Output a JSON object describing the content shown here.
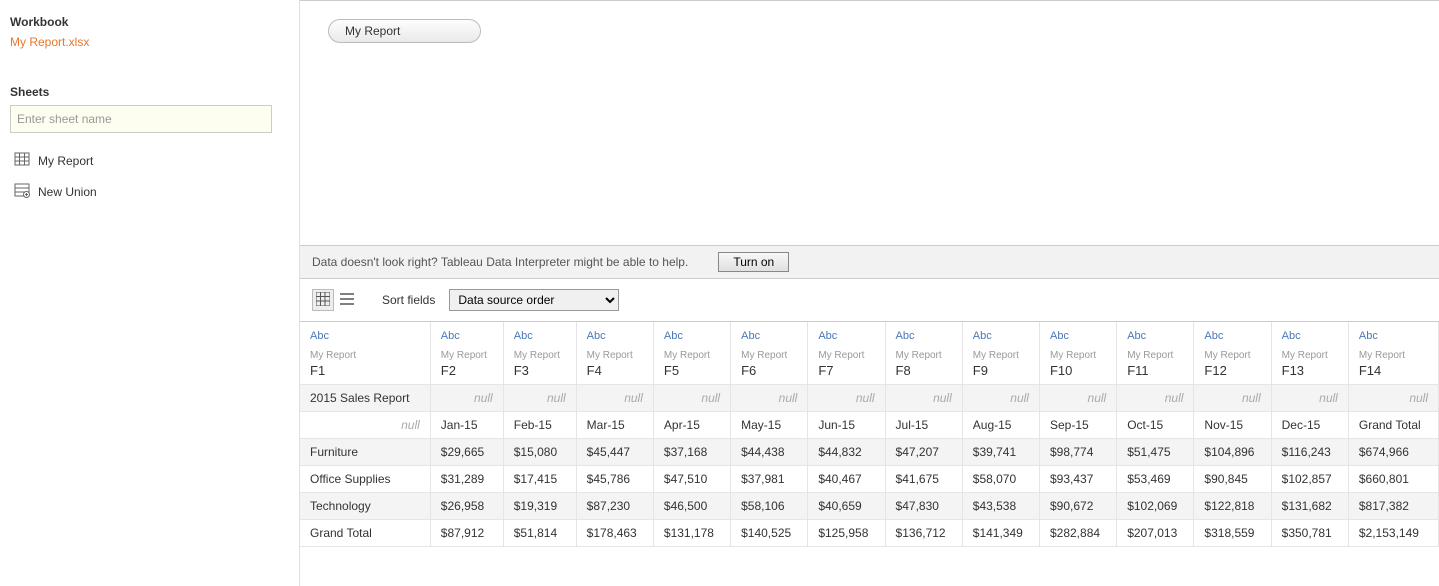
{
  "sidebar": {
    "workbook_label": "Workbook",
    "file_name": "My Report.xlsx",
    "sheets_label": "Sheets",
    "sheet_search_placeholder": "Enter sheet name",
    "sheet_item": "My Report",
    "new_union": "New Union"
  },
  "canvas": {
    "pill_label": "My Report"
  },
  "interpreter": {
    "message": "Data doesn't look right? Tableau Data Interpreter might be able to help.",
    "button": "Turn on"
  },
  "controls": {
    "sort_label": "Sort fields",
    "sort_value": "Data source order"
  },
  "grid": {
    "col_type": "Abc",
    "col_source": "My Report",
    "columns": [
      "F1",
      "F2",
      "F3",
      "F4",
      "F5",
      "F6",
      "F7",
      "F8",
      "F9",
      "F10",
      "F11",
      "F12",
      "F13",
      "F14"
    ],
    "null_text": "null",
    "rows": [
      [
        "2015 Sales Report",
        null,
        null,
        null,
        null,
        null,
        null,
        null,
        null,
        null,
        null,
        null,
        null,
        null
      ],
      [
        null,
        "Jan-15",
        "Feb-15",
        "Mar-15",
        "Apr-15",
        "May-15",
        "Jun-15",
        "Jul-15",
        "Aug-15",
        "Sep-15",
        "Oct-15",
        "Nov-15",
        "Dec-15",
        "Grand Total"
      ],
      [
        "Furniture",
        "$29,665",
        "$15,080",
        "$45,447",
        "$37,168",
        "$44,438",
        "$44,832",
        "$47,207",
        "$39,741",
        "$98,774",
        "$51,475",
        "$104,896",
        "$116,243",
        "$674,966"
      ],
      [
        "Office Supplies",
        "$31,289",
        "$17,415",
        "$45,786",
        "$47,510",
        "$37,981",
        "$40,467",
        "$41,675",
        "$58,070",
        "$93,437",
        "$53,469",
        "$90,845",
        "$102,857",
        "$660,801"
      ],
      [
        "Technology",
        "$26,958",
        "$19,319",
        "$87,230",
        "$46,500",
        "$58,106",
        "$40,659",
        "$47,830",
        "$43,538",
        "$90,672",
        "$102,069",
        "$122,818",
        "$131,682",
        "$817,382"
      ],
      [
        "Grand Total",
        "$87,912",
        "$51,814",
        "$178,463",
        "$131,178",
        "$140,525",
        "$125,958",
        "$136,712",
        "$141,349",
        "$282,884",
        "$207,013",
        "$318,559",
        "$350,781",
        "$2,153,149"
      ]
    ]
  }
}
